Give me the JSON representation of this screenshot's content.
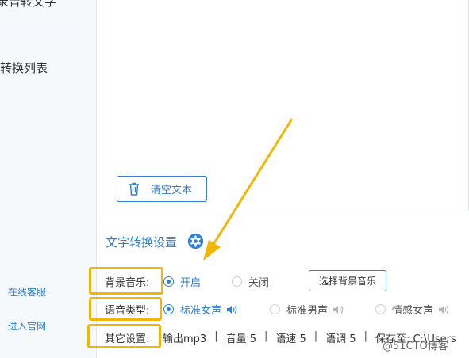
{
  "sidebar": {
    "top_item": "录音转文字",
    "list_item": "转换列表",
    "service_link": "在线客服",
    "website_link": "进入官网"
  },
  "editor": {
    "clear_label": "清空文本"
  },
  "settings": {
    "title": "文字转换设置",
    "bg_music": {
      "label": "背景音乐:",
      "options": [
        "开启",
        "关闭"
      ],
      "selected": "开启",
      "pick_button": "选择背景音乐"
    },
    "voice_type": {
      "label": "语音类型:",
      "options": [
        "标准女声",
        "标准男声",
        "情感女声"
      ],
      "selected": "标准女声"
    },
    "other": {
      "label": "其它设置:",
      "items": [
        "输出mp3",
        "音量 5",
        "语速 5",
        "语调 5",
        "保存至: C:\\Users"
      ]
    }
  },
  "watermark": "@51CTO博客",
  "colors": {
    "accent": "#2f7fd6",
    "highlight": "#f2b705"
  }
}
